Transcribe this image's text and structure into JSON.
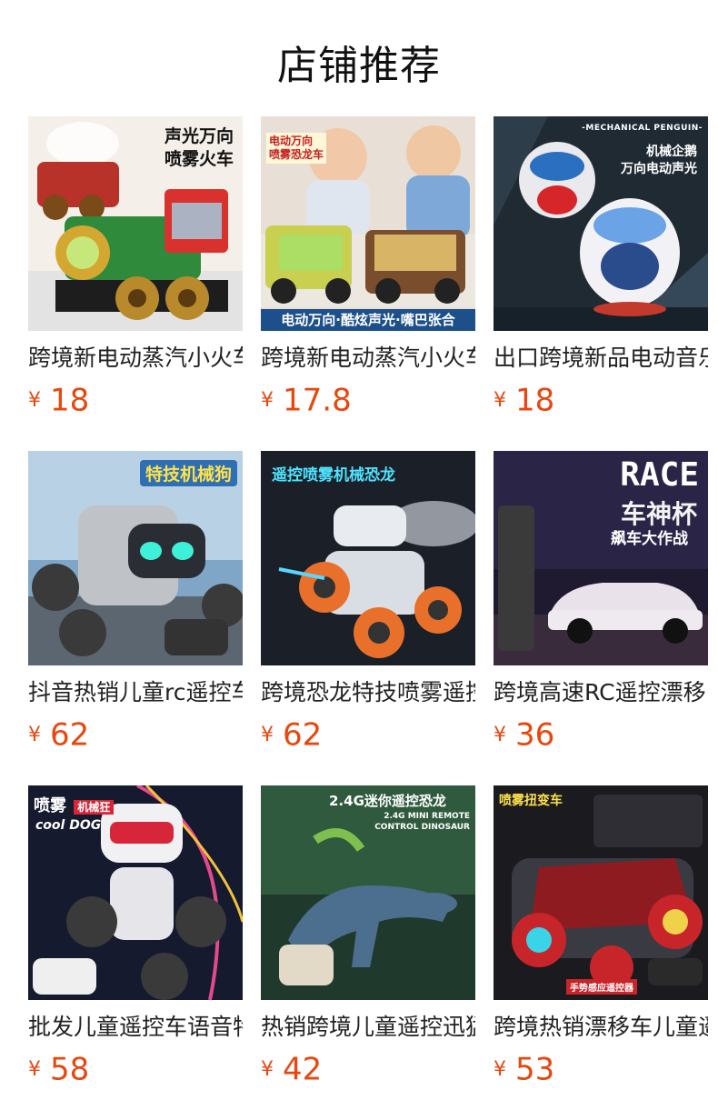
{
  "page": {
    "title": "店铺推荐"
  },
  "currency": "¥",
  "colors": {
    "price": "#e8470f",
    "title": "#111111"
  },
  "products": [
    {
      "name": "跨境新电动蒸汽小火车",
      "price": "18",
      "image_text": [
        "声光万向",
        "喷雾火车"
      ],
      "icon": "train-image"
    },
    {
      "name": "跨境新电动蒸汽小火车",
      "price": "17.8",
      "image_text": [
        "电动万向",
        "喷雾恐龙车",
        "电动万向·酷炫声光·嘴巴张合"
      ],
      "icon": "dino-car-image"
    },
    {
      "name": "出口跨境新品电动音乐",
      "price": "18",
      "image_text": [
        "-MECHANICAL PENGUIN-",
        "机械企鹅",
        "万向电动声光"
      ],
      "icon": "penguin-image"
    },
    {
      "name": "抖音热销儿童rc遥控车",
      "price": "62",
      "image_text": [
        "特技机械狗"
      ],
      "icon": "robot-dog-image"
    },
    {
      "name": "跨境恐龙特技喷雾遥控",
      "price": "62",
      "image_text": [
        "遥控喷雾机械恐龙"
      ],
      "icon": "mech-dino-image"
    },
    {
      "name": "跨境高速RC遥控漂移",
      "price": "36",
      "image_text": [
        "RACE",
        "车神杯",
        "飙车大作战"
      ],
      "icon": "race-car-image"
    },
    {
      "name": "批发儿童遥控车语音特",
      "price": "58",
      "image_text": [
        "喷雾",
        "机械狂",
        "cool DOG"
      ],
      "icon": "cool-dog-image"
    },
    {
      "name": "热销跨境儿童遥控迅猛龙",
      "price": "42",
      "image_text": [
        "2.4G迷你遥控恐龙",
        "2.4G MINI REMOTE",
        "CONTROL DINOSAUR"
      ],
      "icon": "raptor-image"
    },
    {
      "name": "跨境热销漂移车儿童遥",
      "price": "53",
      "image_text": [
        "喷雾扭变车",
        "手势感应遥控器"
      ],
      "icon": "stunt-car-image"
    }
  ]
}
